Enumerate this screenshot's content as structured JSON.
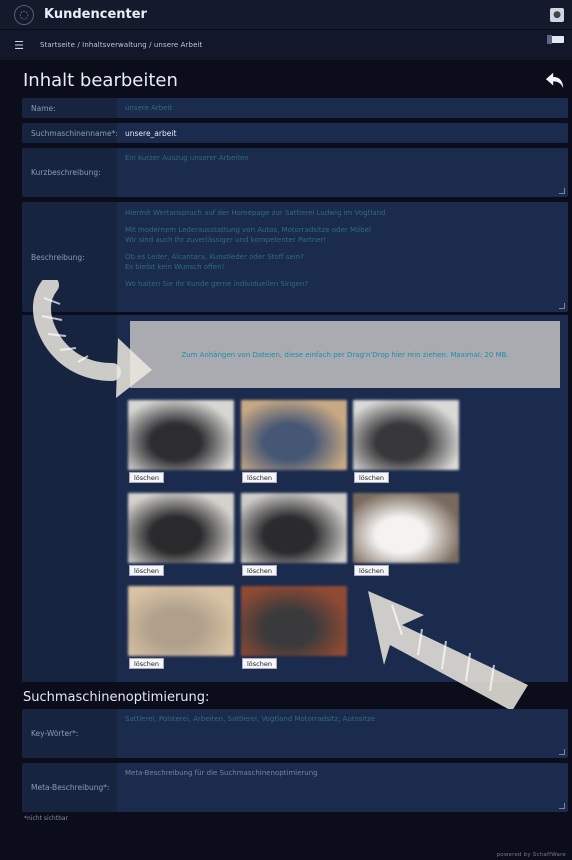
{
  "app": {
    "title": "Kundencenter"
  },
  "breadcrumb": "Startseite / Inhaltsverwaltung / unsere Arbeit",
  "page": {
    "title": "Inhalt bearbeiten"
  },
  "form": {
    "name_label": "Name:",
    "name_value": "unsere Arbeit",
    "slug_label": "Suchmaschinenname*:",
    "slug_value": "unsere_arbeit",
    "short_label": "Kurzbeschreibung:",
    "short_placeholder": "Ein kurzer Auszug unserer Arbeiten",
    "desc_label": "Beschreibung:",
    "desc_lines": [
      "Hiermit Wertanspruch auf der Homepage zur Sattlerei Ludwig im Vogtland",
      "",
      "Mit modernem Lederausstattung von Autos, Motorradsitze oder Möbel",
      "Wir sind auch Ihr zuverlässiger und kompetenter Partner!",
      "",
      "Ob es Leder, Alcantara, Kunstleder oder Stoff sein?",
      "Es bleibt kein Wunsch offen!",
      "",
      "Wo halten Sie Ihr Kunde gerne individuellen Singen?"
    ],
    "dropzone_text": "Zum Anhängen von Dateien, diese einfach per Drag'n'Drop hier rein ziehen. Maximal: 20 MB.",
    "delete_label": "löschen"
  },
  "images": [
    {
      "c1": "#d6d6d2",
      "c2": "#2d2d31"
    },
    {
      "c1": "#c8a984",
      "c2": "#455774"
    },
    {
      "c1": "#d9d9d6",
      "c2": "#38383b"
    },
    {
      "c1": "#d4d2cc",
      "c2": "#2a2a2c"
    },
    {
      "c1": "#cfcdc8",
      "c2": "#2b2b2e"
    },
    {
      "c1": "#7a6a5d",
      "c2": "#f4f3f1"
    },
    {
      "c1": "#d8c3a4",
      "c2": "#b0a08b"
    },
    {
      "c1": "#8f4a33",
      "c2": "#3a3a3c"
    }
  ],
  "seo": {
    "title": "Suchmaschinenoptimierung:",
    "keywords_label": "Key-Wörter*:",
    "keywords_value": "Sattlerei, Polsterei, Arbeiten, Sattlerei, Vogtland Motorradsitz, Autositze",
    "meta_label": "Meta-Beschreibung*:",
    "meta_placeholder": "Meta-Beschreibung für die Suchmaschinenoptimierung"
  },
  "footnote": "*nicht sichtbar",
  "powered": "powered by SchaffWare"
}
